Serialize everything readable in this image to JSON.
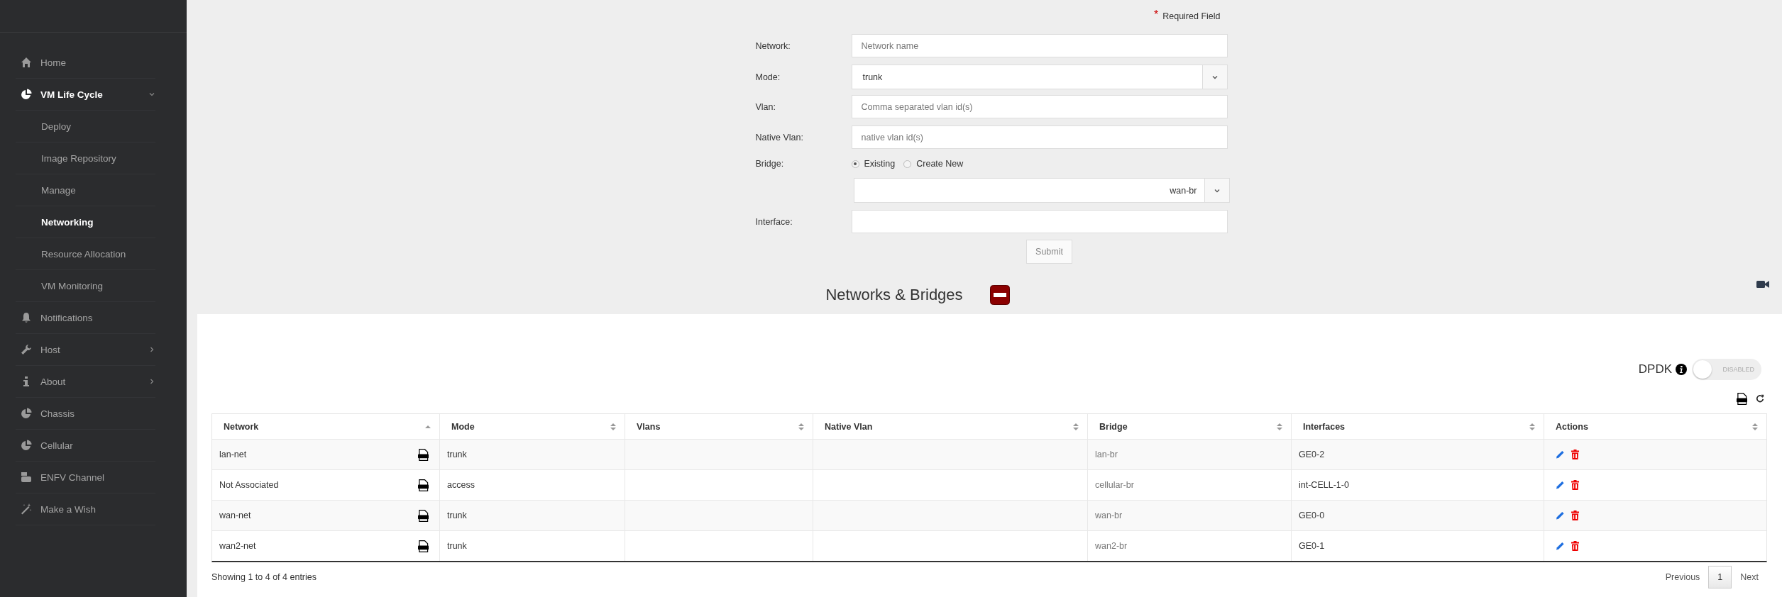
{
  "sidebar": {
    "items": [
      {
        "label": "Home",
        "kind": "link"
      },
      {
        "label": "VM Life Cycle",
        "kind": "group",
        "expanded": true,
        "children": [
          {
            "label": "Deploy",
            "selected": false
          },
          {
            "label": "Image Repository",
            "selected": false
          },
          {
            "label": "Manage",
            "selected": false
          },
          {
            "label": "Networking",
            "selected": true
          },
          {
            "label": "Resource Allocation",
            "selected": false
          },
          {
            "label": "VM Monitoring",
            "selected": false
          }
        ]
      },
      {
        "label": "Notifications",
        "kind": "link"
      },
      {
        "label": "Host",
        "kind": "group",
        "expanded": false
      },
      {
        "label": "About",
        "kind": "group",
        "expanded": false
      },
      {
        "label": "Chassis",
        "kind": "link"
      },
      {
        "label": "Cellular",
        "kind": "link"
      },
      {
        "label": "ENFV Channel",
        "kind": "link"
      },
      {
        "label": "Make a Wish",
        "kind": "link"
      }
    ]
  },
  "form": {
    "required_mark": "*",
    "required_note": "Required Field",
    "fields": [
      {
        "kind": "text",
        "label": "Network:",
        "placeholder": "Network name"
      },
      {
        "kind": "select",
        "label": "Mode:",
        "value": "trunk"
      },
      {
        "kind": "text",
        "label": "Vlan:",
        "placeholder": "Comma separated vlan id(s)"
      },
      {
        "kind": "text",
        "label": "Native Vlan:",
        "placeholder": "native vlan id(s)"
      },
      {
        "kind": "radio",
        "label": "Bridge:",
        "options": [
          {
            "label": "Existing",
            "selected": true
          },
          {
            "label": "Create New",
            "selected": false
          }
        ]
      },
      {
        "kind": "bridge-select",
        "value": "wan-br"
      },
      {
        "kind": "text",
        "label": "Interface:"
      }
    ],
    "submit": "Submit"
  },
  "section": {
    "title": "Networks & Bridges"
  },
  "dpdk": {
    "label": "DPDK",
    "on": false,
    "state_text": "DISABLED"
  },
  "table": {
    "columns": [
      {
        "label": "Network",
        "sorted": true
      },
      {
        "label": "Mode",
        "sorted": false
      },
      {
        "label": "Vlans",
        "sorted": false
      },
      {
        "label": "Native Vlan",
        "sorted": false
      },
      {
        "label": "Bridge",
        "sorted": false
      },
      {
        "label": "Interfaces",
        "sorted": false
      },
      {
        "label": "Actions",
        "sorted": false
      }
    ],
    "rows": [
      {
        "network": "lan-net",
        "mode": "trunk",
        "bridge": "lan-br",
        "interfaces": "GE0-2"
      },
      {
        "network": "Not Associated",
        "mode": "access",
        "bridge": "cellular-br",
        "interfaces": "int-CELL-1-0"
      },
      {
        "network": "wan-net",
        "mode": "trunk",
        "bridge": "wan-br",
        "interfaces": "GE0-0"
      },
      {
        "network": "wan2-net",
        "mode": "trunk",
        "bridge": "wan2-br",
        "interfaces": "GE0-1"
      }
    ],
    "info": "Showing 1 to 4 of 4 entries"
  },
  "pagination": {
    "previous": "Previous",
    "pages": [
      {
        "label": "1",
        "selected": true
      }
    ],
    "next": "Next"
  }
}
